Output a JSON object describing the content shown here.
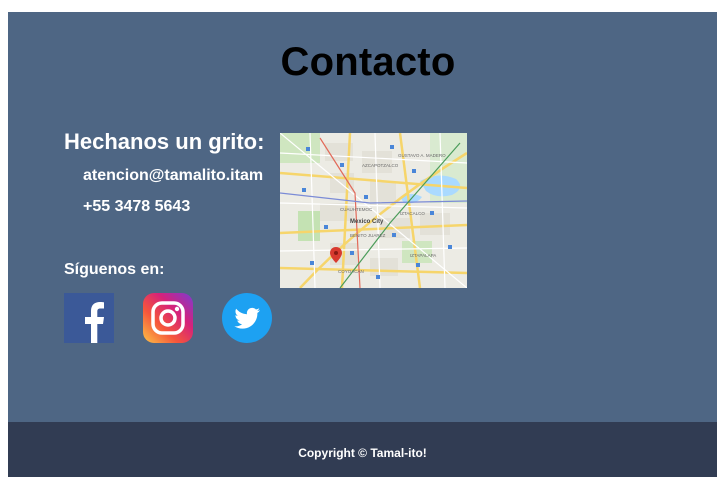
{
  "contact": {
    "title": "Contacto",
    "heading": "Hechanos un grito:",
    "email": "atencion@tamalito.itam",
    "phone": "+55 3478 5643",
    "follow_label": "Síguenos en:"
  },
  "social": [
    {
      "icon": "facebook-icon",
      "color": "#3b5998"
    },
    {
      "icon": "instagram-icon",
      "color": "#c13584"
    },
    {
      "icon": "twitter-icon",
      "color": "#1da1f2"
    }
  ],
  "map": {
    "label": "Mexico City",
    "districts": [
      "AZCAPOTZALCO",
      "GUSTAVO A. MADERO",
      "CUAUHTEMOC",
      "IZTACALCO",
      "BENITO JUAREZ",
      "COYOACAN",
      "IZTAPALAPA",
      "VENUSTIANO CARRANZA"
    ]
  },
  "footer": {
    "copyright": "Copyright © Tamal-ito!"
  },
  "colors": {
    "section_bg": "#4e6684",
    "footer_bg": "#313c53"
  }
}
